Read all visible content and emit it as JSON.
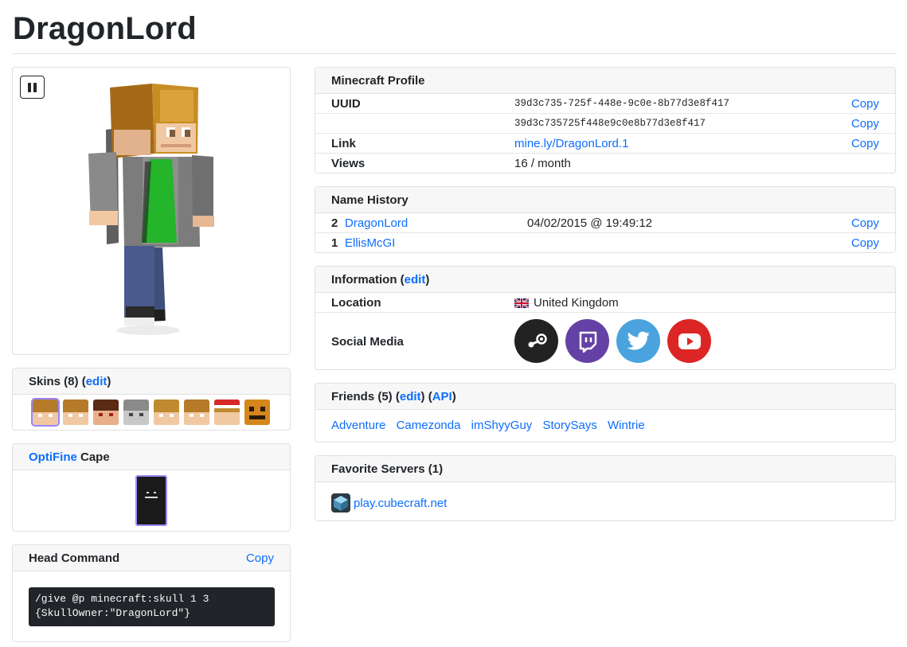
{
  "page": {
    "title": "DragonLord"
  },
  "skins": {
    "label": "Skins (8)",
    "open_paren": "(",
    "edit": "edit",
    "close_paren": ")"
  },
  "cape": {
    "brand": "OptiFine",
    "label": "Cape"
  },
  "head": {
    "title": "Head Command",
    "copy": "Copy",
    "command": "/give @p minecraft:skull 1 3 {SkullOwner:\"DragonLord\"}"
  },
  "profile": {
    "title": "Minecraft Profile",
    "uuid_label": "UUID",
    "uuid": "39d3c735-725f-448e-9c0e-8b77d3e8f417",
    "uuid_short": "39d3c735725f448e9c0e8b77d3e8f417",
    "link_label": "Link",
    "link": "mine.ly/DragonLord.1",
    "views_label": "Views",
    "views": "16 / month",
    "copy": "Copy"
  },
  "names": {
    "title": "Name History",
    "items": [
      {
        "num": "2",
        "name": "DragonLord",
        "date": "04/02/2015 @ 19:49:12"
      },
      {
        "num": "1",
        "name": "EllisMcGI",
        "date": ""
      }
    ],
    "copy": "Copy"
  },
  "info": {
    "title": "Information",
    "edit": "edit",
    "location_label": "Location",
    "location": "United Kingdom",
    "social_label": "Social Media",
    "social": [
      {
        "name": "steam",
        "color": "#222222"
      },
      {
        "name": "twitch",
        "color": "#6441a5"
      },
      {
        "name": "twitter",
        "color": "#4aa3df"
      },
      {
        "name": "youtube",
        "color": "#dc2626"
      }
    ]
  },
  "friends": {
    "title": "Friends (5)",
    "edit": "edit",
    "api": "API",
    "list": [
      "Adventure",
      "Camezonda",
      "imShyyGuy",
      "StorySays",
      "Wintrie"
    ]
  },
  "servers": {
    "title": "Favorite Servers (1)",
    "items": [
      "play.cubecraft.net"
    ]
  }
}
